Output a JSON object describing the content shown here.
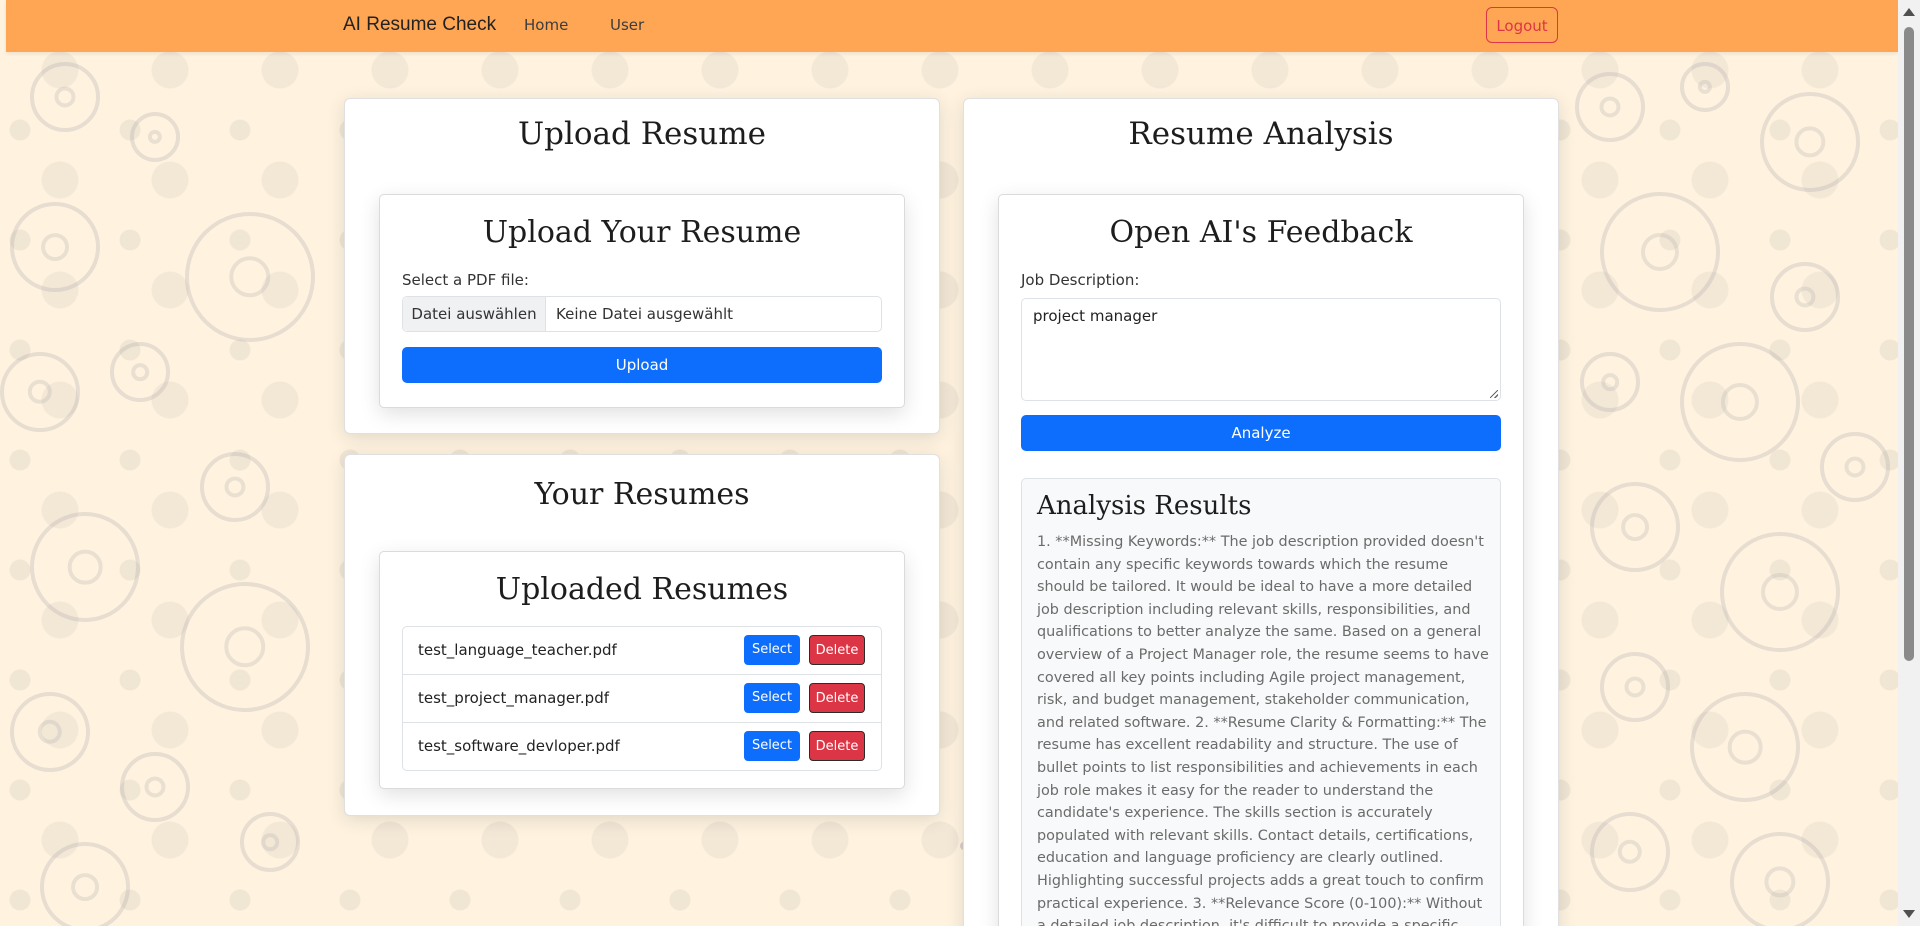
{
  "navbar": {
    "brand": "AI Resume Check",
    "links": [
      "Home",
      "User"
    ],
    "logout_label": "Logout"
  },
  "upload_panel": {
    "title": "Upload Resume",
    "card_title": "Upload Your Resume",
    "file_label": "Select a PDF file:",
    "choose_file_label": "Datei auswählen",
    "no_file_text": "Keine Datei ausgewählt",
    "upload_button": "Upload"
  },
  "resumes_panel": {
    "title": "Your Resumes",
    "card_title": "Uploaded Resumes",
    "files": [
      "test_language_teacher.pdf",
      "test_project_manager.pdf",
      "test_software_devloper.pdf"
    ],
    "select_label": "Select",
    "delete_label": "Delete"
  },
  "analysis_panel": {
    "title": "Resume Analysis",
    "card_title": "Open AI's Feedback",
    "job_label": "Job Description:",
    "job_value": "project manager",
    "analyze_button": "Analyze",
    "results_title": "Analysis Results",
    "results_text": "1. **Missing Keywords:** The job description provided doesn't contain any specific keywords towards which the resume should be tailored. It would be ideal to have a more detailed job description including relevant skills, responsibilities, and qualifications to better analyze the same. Based on a general overview of a Project Manager role, the resume seems to have covered all key points including Agile project management, risk, and budget management, stakeholder communication, and related software. 2. **Resume Clarity & Formatting:** The resume has excellent readability and structure. The use of bullet points to list responsibilities and achievements in each job role makes it easy for the reader to understand the candidate's experience. The skills section is accurately populated with relevant skills. Contact details, certifications, education and language proficiency are clearly outlined. Highlighting successful projects adds a great touch to confirm practical experience. 3. **Relevance Score (0-100):** Without a detailed job description, it's difficult to provide a specific score. However, based on the"
  },
  "colors": {
    "navbar": "#ffa654",
    "primary": "#0d6efd",
    "danger": "#dc3545",
    "background": "#fff3e0"
  }
}
